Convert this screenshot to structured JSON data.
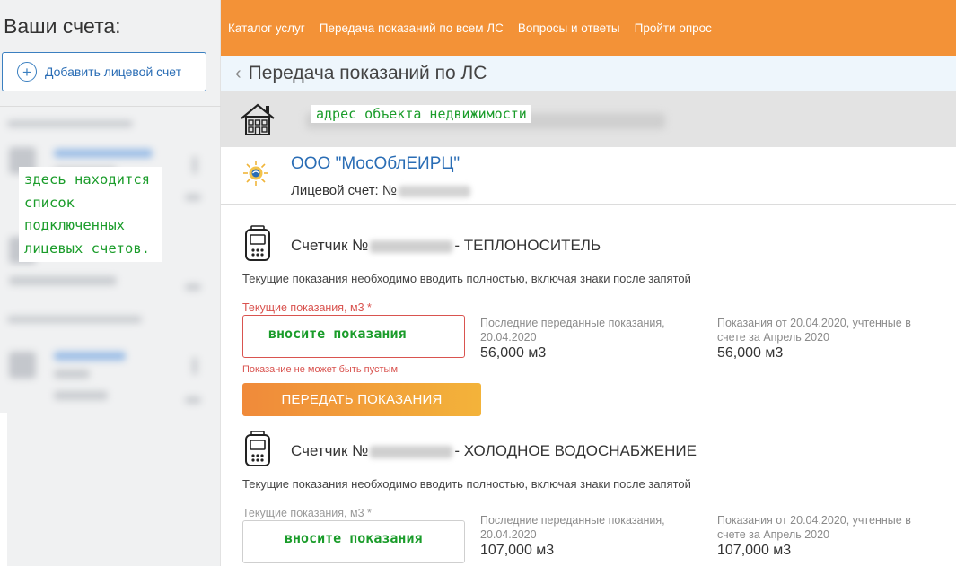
{
  "sidebar": {
    "title": "Ваши счета:",
    "add_button": "Добавить лицевой счет",
    "annotation": "здесь находится список подключенных лицевых счетов."
  },
  "nav": {
    "items": [
      "Каталог услуг",
      "Передача показаний по всем ЛС",
      "Вопросы и ответы",
      "Пройти опрос"
    ]
  },
  "page": {
    "title": "Передача показаний по ЛС",
    "back_icon": "chevron-left-icon"
  },
  "address": {
    "icon": "house-icon",
    "annotation": "адрес объекта недвижимости"
  },
  "company": {
    "icon": "mosoblercz-logo-icon",
    "name": "ООО \"МосОблЕИРЦ\"",
    "account_label": "Лицевой счет: №"
  },
  "meters": [
    {
      "icon": "meter-icon",
      "title_prefix": "Счетчик №",
      "title_suffix": "- ТЕПЛОНОСИТЕЛЬ",
      "hint": "Текущие показания необходимо вводить полностью, включая знаки после запятой",
      "field_label": "Текущие показания, м3 *",
      "input_annotation": "вносите показания",
      "error": "Показание не может быть пустым",
      "submit": "ПЕРЕДАТЬ ПОКАЗАНИЯ",
      "last_label": "Последние переданные показания, 20.04.2020",
      "last_value": "56,000 м3",
      "billed_label": "Показания от 20.04.2020, учтенные в счете за Апрель 2020",
      "billed_value": "56,000 м3"
    },
    {
      "icon": "meter-icon",
      "title_prefix": "Счетчик №",
      "title_suffix": "- ХОЛОДНОЕ ВОДОСНАБЖЕНИЕ",
      "hint": "Текущие показания необходимо вводить полностью, включая знаки после запятой",
      "field_label": "Текущие показания, м3 *",
      "input_annotation": "вносите показания",
      "last_label": "Последние переданные показания, 20.04.2020",
      "last_value": "107,000 м3",
      "billed_label": "Показания от 20.04.2020, учтенные в счете за Апрель 2020",
      "billed_value": "107,000 м3"
    }
  ],
  "colors": {
    "accent": "#f39237",
    "link": "#2a6db5",
    "error": "#d9534f",
    "annotation": "#1a9c2a"
  }
}
